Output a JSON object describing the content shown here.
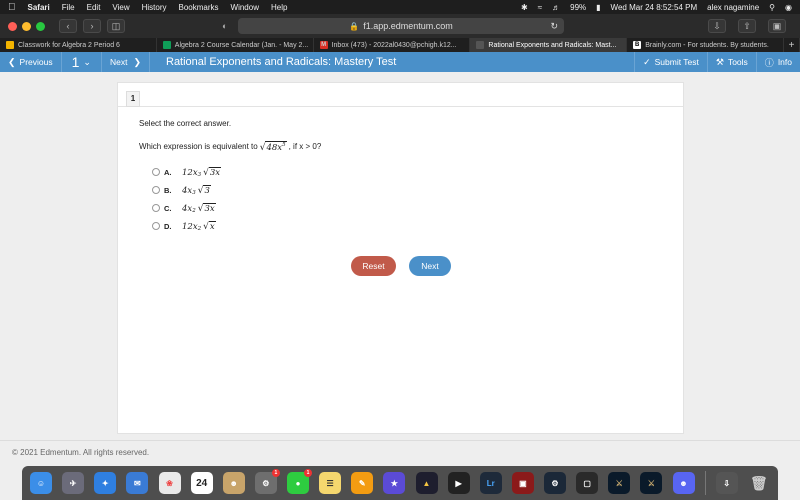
{
  "menubar": {
    "apple": "",
    "items": [
      "Safari",
      "File",
      "Edit",
      "View",
      "History",
      "Bookmarks",
      "Window",
      "Help"
    ],
    "battery": "99%",
    "datetime": "Wed Mar 24  8:52:54 PM",
    "user": "alex nagamine"
  },
  "browser": {
    "url": "f1.app.edmentum.com",
    "tabs": [
      {
        "label": "Classwork for Algebra 2 Period 6",
        "color": "#f4b400"
      },
      {
        "label": "Algebra 2 Course Calendar (Jan. - May 2...",
        "color": "#0f9d58"
      },
      {
        "label": "Inbox (473) - 2022al0430@pchigh.k12...",
        "color": "#d93025"
      },
      {
        "label": "Rational Exponents and Radicals: Mast...",
        "color": "#555555"
      },
      {
        "label": "Brainly.com - For students. By students.",
        "color": "#ffffff"
      }
    ],
    "new_tab": "+"
  },
  "appbar": {
    "previous": "Previous",
    "question_number": "1",
    "next": "Next",
    "title": "Rational Exponents and Radicals: Mastery Test",
    "submit": "Submit Test",
    "tools": "Tools",
    "info": "Info"
  },
  "question": {
    "number": "1",
    "prompt": "Select the correct answer.",
    "text_before": "Which expression is equivalent to",
    "radicand": "48x",
    "radicand_exp": "5",
    "text_after": ", if x > 0?",
    "options": [
      {
        "letter": "A.",
        "coef": "12x",
        "exp": "3",
        "radicand": "3x"
      },
      {
        "letter": "B.",
        "coef": "4x",
        "exp": "3",
        "radicand": "3"
      },
      {
        "letter": "C.",
        "coef": "4x",
        "exp": "2",
        "radicand": "3x"
      },
      {
        "letter": "D.",
        "coef": "12x",
        "exp": "2",
        "radicand": "x"
      }
    ]
  },
  "buttons": {
    "reset": "Reset",
    "next": "Next"
  },
  "footer": "© 2021 Edmentum. All rights reserved.",
  "dock": {
    "calendar_day": "24",
    "badge_count": "1",
    "lightroom": "Lr"
  }
}
